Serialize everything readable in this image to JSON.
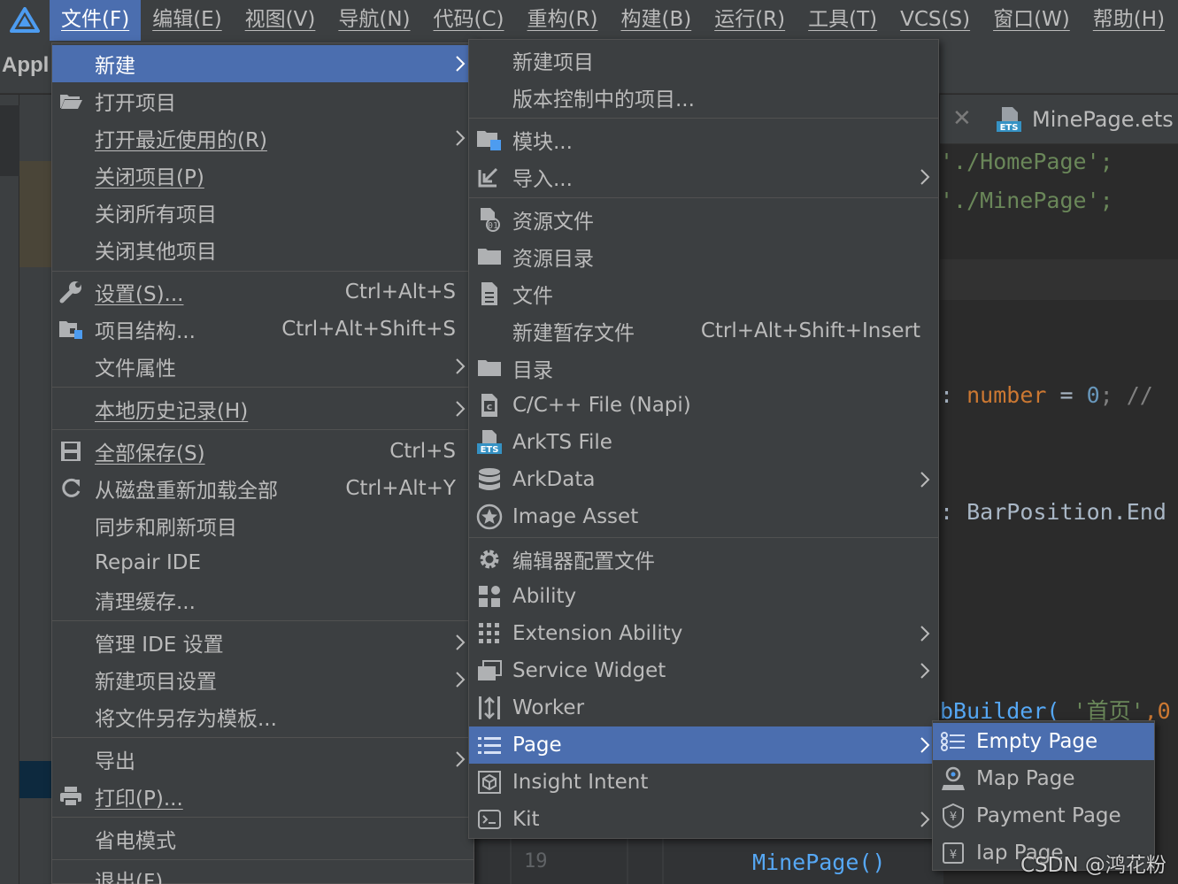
{
  "menubar": {
    "items": [
      "文件(F)",
      "编辑(E)",
      "视图(V)",
      "导航(N)",
      "代码(C)",
      "重构(R)",
      "构建(B)",
      "运行(R)",
      "工具(T)",
      "VCS(S)",
      "窗口(W)",
      "帮助(H)"
    ],
    "active_index": 0
  },
  "project": {
    "name": "Appl"
  },
  "editor": {
    "tab_label": "MinePage.ets",
    "lines": [
      {
        "text": "'./HomePage';"
      },
      {
        "text": "'./MinePage';"
      },
      {
        "a": ": ",
        "b": "number",
        "c": " = ",
        "d": "0",
        "e": "; //"
      },
      {
        "a": ": ",
        "b": "BarPosition.End"
      },
      {
        "a": "bBuilder(",
        "b": " '首页'",
        "c": ",0"
      }
    ],
    "bottom_line_number": "19",
    "bottom_code": "MinePage()"
  },
  "file_menu": {
    "items": [
      {
        "label": "新建",
        "shortcut": "",
        "submenu": true,
        "icon": "none",
        "selected": true
      },
      {
        "label": "打开项目",
        "shortcut": "",
        "submenu": false,
        "icon": "folder-open-icon"
      },
      {
        "label": "打开最近使用的(R)",
        "shortcut": "",
        "submenu": true,
        "icon": "none"
      },
      {
        "label": "关闭项目(P)",
        "shortcut": "",
        "submenu": false,
        "icon": "none"
      },
      {
        "label": "关闭所有项目",
        "shortcut": "",
        "submenu": false,
        "icon": "none"
      },
      {
        "label": "关闭其他项目",
        "shortcut": "",
        "submenu": false,
        "icon": "none"
      },
      {
        "label": "设置(S)...",
        "shortcut": "Ctrl+Alt+S",
        "submenu": false,
        "icon": "wrench-icon"
      },
      {
        "label": "项目结构...",
        "shortcut": "Ctrl+Alt+Shift+S",
        "submenu": false,
        "icon": "project-structure-icon"
      },
      {
        "label": "文件属性",
        "shortcut": "",
        "submenu": true,
        "icon": "none"
      },
      {
        "label": "本地历史记录(H)",
        "shortcut": "",
        "submenu": true,
        "icon": "none"
      },
      {
        "label": "全部保存(S)",
        "shortcut": "Ctrl+S",
        "submenu": false,
        "icon": "save-icon"
      },
      {
        "label": "从磁盘重新加载全部",
        "shortcut": "Ctrl+Alt+Y",
        "submenu": false,
        "icon": "reload-icon"
      },
      {
        "label": "同步和刷新项目",
        "shortcut": "",
        "submenu": false,
        "icon": "none"
      },
      {
        "label": "Repair IDE",
        "shortcut": "",
        "submenu": false,
        "icon": "none"
      },
      {
        "label": "清理缓存...",
        "shortcut": "",
        "submenu": false,
        "icon": "none"
      },
      {
        "label": "管理 IDE 设置",
        "shortcut": "",
        "submenu": true,
        "icon": "none"
      },
      {
        "label": "新建项目设置",
        "shortcut": "",
        "submenu": true,
        "icon": "none"
      },
      {
        "label": "将文件另存为模板...",
        "shortcut": "",
        "submenu": false,
        "icon": "none"
      },
      {
        "label": "导出",
        "shortcut": "",
        "submenu": true,
        "icon": "none"
      },
      {
        "label": "打印(P)...",
        "shortcut": "",
        "submenu": false,
        "icon": "printer-icon"
      },
      {
        "label": "省电模式",
        "shortcut": "",
        "submenu": false,
        "icon": "none"
      },
      {
        "label": "退出(F)",
        "shortcut": "",
        "submenu": false,
        "icon": "none"
      }
    ]
  },
  "new_menu": {
    "items": [
      {
        "label": "新建项目",
        "shortcut": "",
        "submenu": false,
        "icon": "none"
      },
      {
        "label": "版本控制中的项目...",
        "shortcut": "",
        "submenu": false,
        "icon": "none"
      },
      {
        "label": "模块...",
        "shortcut": "",
        "submenu": false,
        "icon": "module-icon"
      },
      {
        "label": "导入...",
        "shortcut": "",
        "submenu": true,
        "icon": "import-icon"
      },
      {
        "label": "资源文件",
        "shortcut": "",
        "submenu": false,
        "icon": "resource-file-icon"
      },
      {
        "label": "资源目录",
        "shortcut": "",
        "submenu": false,
        "icon": "folder-icon"
      },
      {
        "label": "文件",
        "shortcut": "",
        "submenu": false,
        "icon": "file-icon"
      },
      {
        "label": "新建暂存文件",
        "shortcut": "Ctrl+Alt+Shift+Insert",
        "submenu": false,
        "icon": "none"
      },
      {
        "label": "目录",
        "shortcut": "",
        "submenu": false,
        "icon": "folder-icon"
      },
      {
        "label": "C/C++ File (Napi)",
        "shortcut": "",
        "submenu": false,
        "icon": "c-file-icon"
      },
      {
        "label": "ArkTS File",
        "shortcut": "",
        "submenu": false,
        "icon": "ets-file-icon"
      },
      {
        "label": "ArkData",
        "shortcut": "",
        "submenu": true,
        "icon": "database-icon"
      },
      {
        "label": "Image Asset",
        "shortcut": "",
        "submenu": false,
        "icon": "image-asset-icon"
      },
      {
        "label": "编辑器配置文件",
        "shortcut": "",
        "submenu": false,
        "icon": "gear-icon"
      },
      {
        "label": "Ability",
        "shortcut": "",
        "submenu": false,
        "icon": "ability-icon"
      },
      {
        "label": "Extension Ability",
        "shortcut": "",
        "submenu": true,
        "icon": "grid-icon"
      },
      {
        "label": "Service Widget",
        "shortcut": "",
        "submenu": true,
        "icon": "widget-icon"
      },
      {
        "label": "Worker",
        "shortcut": "",
        "submenu": false,
        "icon": "worker-icon"
      },
      {
        "label": "Page",
        "shortcut": "",
        "submenu": true,
        "icon": "page-list-icon",
        "selected": true
      },
      {
        "label": "Insight Intent",
        "shortcut": "",
        "submenu": false,
        "icon": "cube-icon"
      },
      {
        "label": "Kit",
        "shortcut": "",
        "submenu": true,
        "icon": "terminal-icon"
      }
    ]
  },
  "page_menu": {
    "items": [
      {
        "label": "Empty Page",
        "icon": "page-list-icon",
        "selected": true
      },
      {
        "label": "Map Page",
        "icon": "map-pin-icon"
      },
      {
        "label": "Payment Page",
        "icon": "payment-icon"
      },
      {
        "label": "Iap Page",
        "icon": "payment-icon"
      }
    ]
  },
  "watermark": "CSDN @鸿花粉",
  "colors": {
    "menu_bg": "#3c3f41",
    "selection": "#4b6eaf",
    "editor_bg": "#2b2b2b"
  }
}
